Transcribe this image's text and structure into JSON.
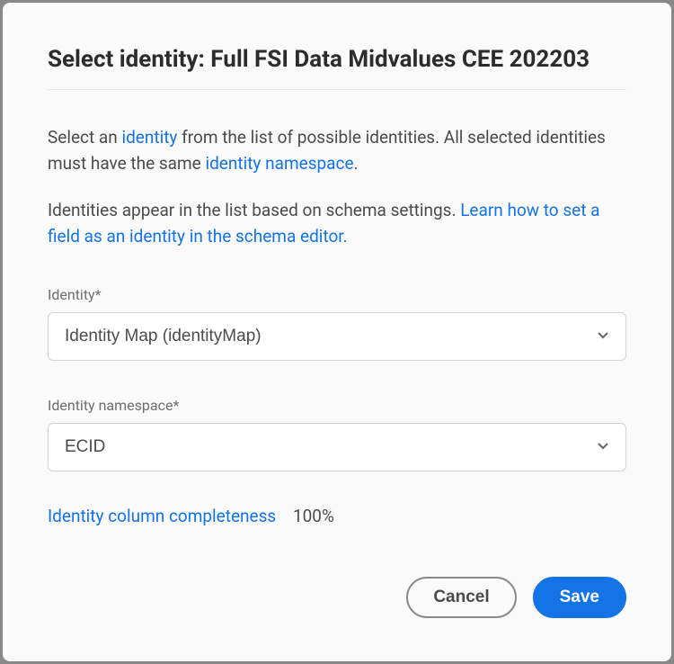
{
  "modal": {
    "title": "Select identity: Full FSI Data Midvalues CEE 202203",
    "desc1a": "Select an ",
    "desc1_link1": "identity",
    "desc1b": " from the list of possible identities. All selected identities must have the same ",
    "desc1_link2": "identity namespace",
    "desc1c": ".",
    "desc2a": "Identities appear in the list based on schema settings. ",
    "desc2_link": "Learn how to set a field as an identity in the schema editor."
  },
  "fields": {
    "identity_label": "Identity*",
    "identity_value": "Identity Map (identityMap)",
    "namespace_label": "Identity namespace*",
    "namespace_value": "ECID"
  },
  "completeness": {
    "label": "Identity column completeness",
    "value": "100%"
  },
  "buttons": {
    "cancel": "Cancel",
    "save": "Save"
  }
}
